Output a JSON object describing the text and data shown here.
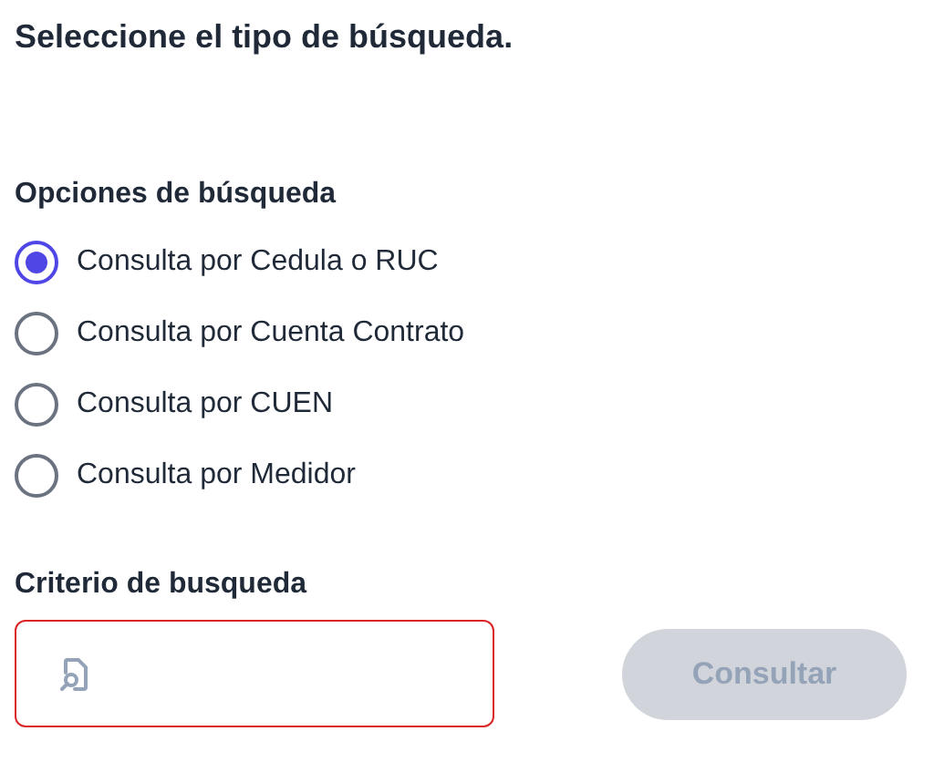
{
  "title": "Seleccione el tipo de búsqueda.",
  "options_label": "Opciones de búsqueda",
  "options": [
    {
      "label": "Consulta por Cedula o RUC",
      "selected": true
    },
    {
      "label": "Consulta por Cuenta Contrato",
      "selected": false
    },
    {
      "label": "Consulta por CUEN",
      "selected": false
    },
    {
      "label": "Consulta por Medidor",
      "selected": false
    }
  ],
  "criteria": {
    "label": "Criterio de busqueda",
    "error": true
  },
  "button": {
    "label": "Consultar",
    "disabled": true
  }
}
